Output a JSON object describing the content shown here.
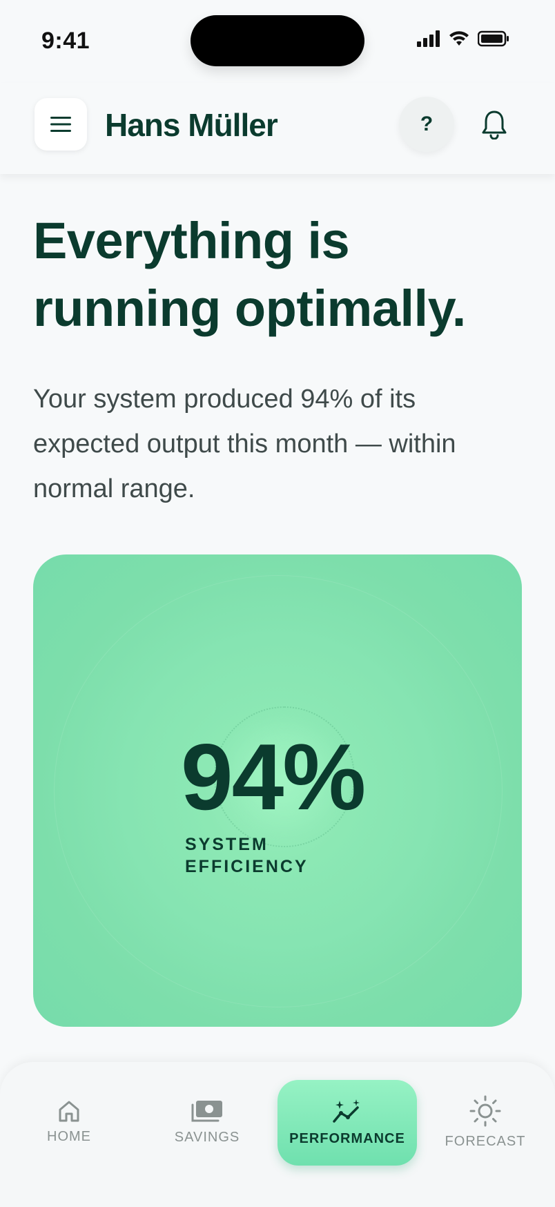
{
  "status_bar": {
    "time": "9:41"
  },
  "header": {
    "title": "Hans Müller",
    "help_label": "?"
  },
  "main": {
    "headline": "Everything is running optimally.",
    "subtext": "Your system produced 94% of its expected output this month — within normal range."
  },
  "efficiency": {
    "value_text": "94%",
    "value": 94,
    "label": "SYSTEM EFFICIENCY"
  },
  "nav": {
    "items": [
      {
        "label": "HOME",
        "icon": "home-icon"
      },
      {
        "label": "SAVINGS",
        "icon": "banknote-icon"
      },
      {
        "label": "PERFORMANCE",
        "icon": "sparkle-chart-icon",
        "active": true
      },
      {
        "label": "FORECAST",
        "icon": "sun-icon"
      }
    ]
  },
  "colors": {
    "primary_text": "#0b3b2e",
    "accent_green": "#7ddeab",
    "background": "#f7f9fa"
  }
}
